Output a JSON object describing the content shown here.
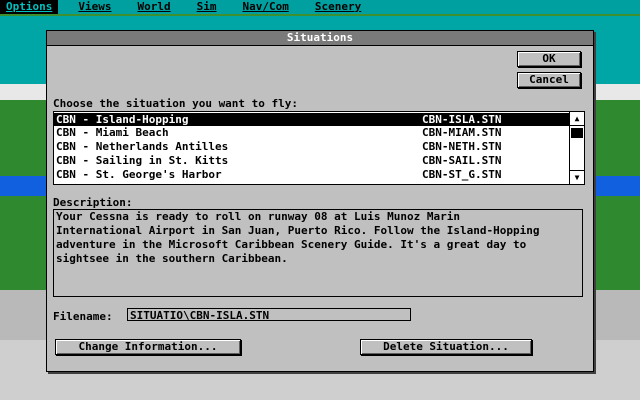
{
  "menubar": {
    "items": [
      "Options",
      "Views",
      "World",
      "Sim",
      "Nav/Com",
      "Scenery"
    ]
  },
  "dialog": {
    "title": "Situations",
    "ok_label": "OK",
    "cancel_label": "Cancel",
    "choose_label": "Choose the situation you want to fly:",
    "list": [
      {
        "name": "CBN - Island-Hopping",
        "file": "CBN-ISLA.STN"
      },
      {
        "name": "CBN - Miami Beach",
        "file": "CBN-MIAM.STN"
      },
      {
        "name": "CBN - Netherlands Antilles",
        "file": "CBN-NETH.STN"
      },
      {
        "name": "CBN - Sailing in St. Kitts",
        "file": "CBN-SAIL.STN"
      },
      {
        "name": "CBN - St. George's Harbor",
        "file": "CBN-ST_G.STN"
      }
    ],
    "selected_index": 0,
    "description_label": "Description:",
    "description_lines": [
      "Your Cessna is ready to roll on runway 08 at Luis Munoz Marin",
      "International Airport in San Juan, Puerto Rico. Follow the Island-Hopping",
      "adventure in the Microsoft Caribbean Scenery Guide. It's a great day to",
      "sightsee in the southern Caribbean."
    ],
    "filename_label": "Filename:",
    "filename_value": "SITUATIO\\CBN-ISLA.STN",
    "change_button": "Change Information...",
    "delete_button": "Delete Situation..."
  }
}
